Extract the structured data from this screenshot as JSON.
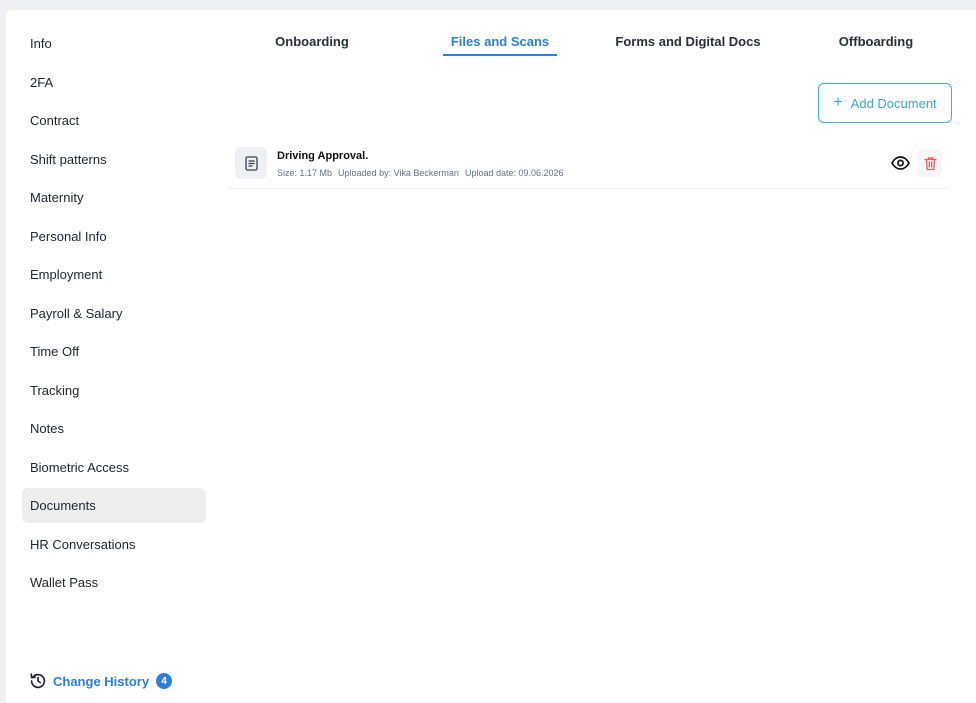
{
  "sidebar": {
    "items": [
      {
        "label": "Info"
      },
      {
        "label": "2FA"
      },
      {
        "label": "Contract"
      },
      {
        "label": "Shift patterns"
      },
      {
        "label": "Maternity"
      },
      {
        "label": "Personal Info"
      },
      {
        "label": "Employment"
      },
      {
        "label": "Payroll & Salary"
      },
      {
        "label": "Time Off"
      },
      {
        "label": "Tracking"
      },
      {
        "label": "Notes"
      },
      {
        "label": "Biometric Access"
      },
      {
        "label": "Documents",
        "active": true
      },
      {
        "label": "HR Conversations"
      },
      {
        "label": "Wallet Pass"
      }
    ],
    "history": {
      "label": "Change History",
      "count": "4",
      "icon": "history-icon"
    }
  },
  "tabs": [
    {
      "label": "Onboarding"
    },
    {
      "label": "Files and Scans",
      "active": true
    },
    {
      "label": "Forms and Digital Docs"
    },
    {
      "label": "Offboarding"
    }
  ],
  "actions": {
    "add_document": "Add Document"
  },
  "documents": [
    {
      "title": "Driving Approval.",
      "size": "Size: 1.17 Mb",
      "uploaded_by": "Uploaded by: Vika Beckerman",
      "upload_date": "Upload date: 09.06.2026"
    }
  ],
  "colors": {
    "accent": "#2f7fd8",
    "add_button": "#3fb0d6",
    "delete": "#e35d5d"
  }
}
